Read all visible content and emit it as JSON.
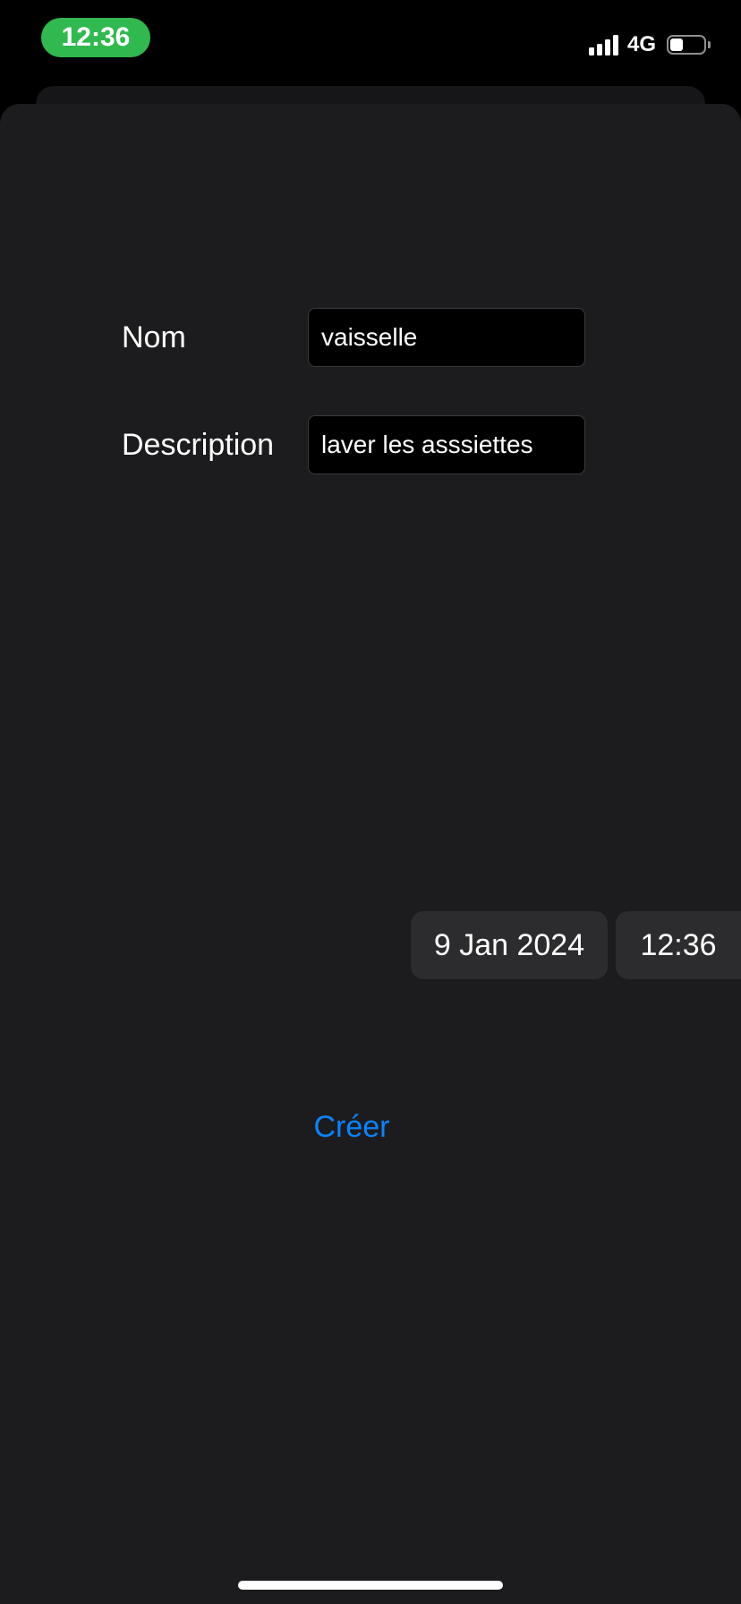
{
  "status_bar": {
    "time": "12:36",
    "network": "4G",
    "icons": {
      "signal": "cellular-signal-icon",
      "battery": "battery-icon"
    },
    "accent_color": "#30b94f"
  },
  "form": {
    "name_label": "Nom",
    "name_value": "vaisselle",
    "description_label": "Description",
    "description_value": "laver les asssiettes"
  },
  "date_picker": {
    "date": "9 Jan 2024",
    "time": "12:36"
  },
  "actions": {
    "create_label": "Créer",
    "create_color": "#0a84ff"
  },
  "theme": {
    "background": "#000000",
    "sheet": "#1c1c1e",
    "pill": "#2c2c2e"
  }
}
